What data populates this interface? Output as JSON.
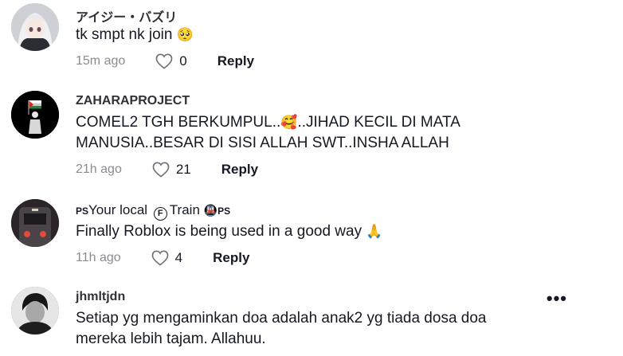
{
  "comments": [
    {
      "username": "アイジー・バズリ",
      "text": "tk smpt nk join",
      "emoji": "🥺",
      "time": "15m ago",
      "likes": "0",
      "reply": "Reply"
    },
    {
      "username": "ZAHARAPROJECT",
      "text_line1": "COMEL2 TGH BERKUMPUL..",
      "emoji": "🥰",
      "text_line1b": "..JIHAD KECIL DI MATA",
      "text_line2": "MANUSIA..BESAR DI SISI ALLAH SWT..INSHA ALLAH",
      "time": "21h ago",
      "likes": "21",
      "reply": "Reply"
    },
    {
      "username_prefix": "PS",
      "username_main": "Your local",
      "username_circle": "F",
      "username_word": "Train",
      "username_emoji": "🚇",
      "username_suffix": "PS",
      "text": "Finally Roblox is being used in a good way",
      "emoji": "🙏",
      "time": "11h ago",
      "likes": "4",
      "reply": "Reply"
    },
    {
      "username": "jhmltjdn",
      "text_line1": "Setiap yg mengaminkan doa adalah anak2 yg tiada dosa doa",
      "text_line2": "mereka lebih tajam. Allahuu.",
      "more": "•••"
    }
  ],
  "icons": {
    "like": "heart-outline-icon",
    "more": "more-options-icon"
  },
  "colors": {
    "time": "#8a8b91",
    "text": "#161823"
  }
}
